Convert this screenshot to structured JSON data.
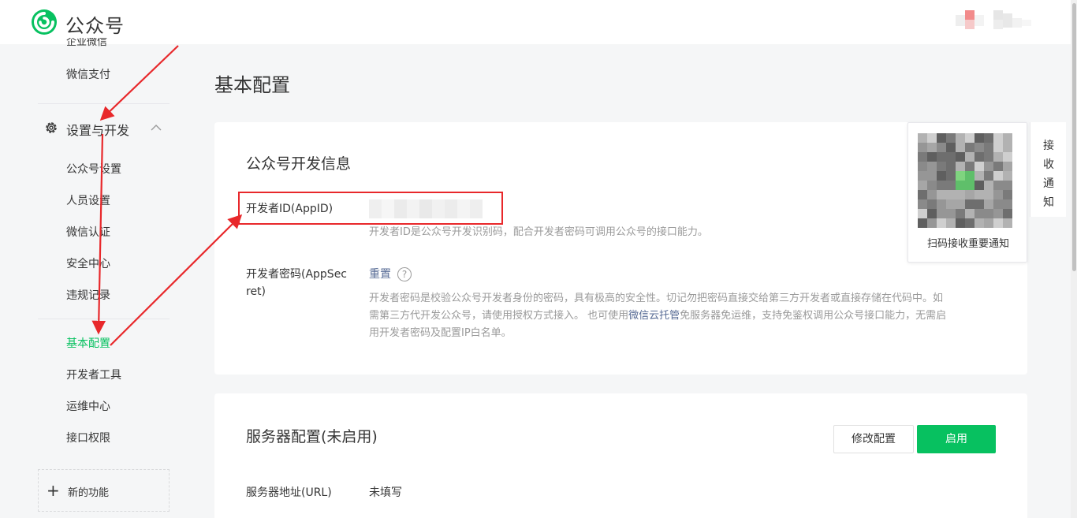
{
  "header": {
    "brand": "公众号"
  },
  "sidebar": {
    "cut_item": "企业微信",
    "wechat_pay": "微信支付",
    "group_label": "设置与开发",
    "items": [
      {
        "label": "公众号设置"
      },
      {
        "label": "人员设置"
      },
      {
        "label": "微信认证"
      },
      {
        "label": "安全中心"
      },
      {
        "label": "违规记录"
      },
      {
        "label": "基本配置"
      },
      {
        "label": "开发者工具"
      },
      {
        "label": "运维中心"
      },
      {
        "label": "接口权限"
      }
    ],
    "new_feature": "新的功能"
  },
  "main": {
    "page_title": "基本配置",
    "dev_info": {
      "title": "公众号开发信息",
      "appid_label": "开发者ID(AppID)",
      "appid_desc": "开发者ID是公众号开发识别码，配合开发者密码可调用公众号的接口能力。",
      "secret_label_1": "开发者密码(AppSec",
      "secret_label_2": "ret)",
      "reset_label": "重置",
      "help_glyph": "?",
      "secret_desc_1": "开发者密码是校验公众号开发者身份的密码，具有极高的安全性。切记勿把密码直接交给第三方开发者或直接存储在代码中。如",
      "secret_desc_2": "需第三方代开发公众号，请使用授权方式接入。 也可使用",
      "secret_desc_link": "微信云托管",
      "secret_desc_3": "免服务器免运维，支持免鉴权调用公众号接口能力，无需启",
      "secret_desc_4": "用开发者密码及配置IP白名单。"
    },
    "server": {
      "title": "服务器配置(未启用)",
      "modify_button": "修改配置",
      "enable_button": "启用",
      "url_label": "服务器地址(URL)",
      "url_value": "未填写"
    }
  },
  "qr_popup": {
    "caption": "扫码接收重要通知"
  },
  "notify_tab": {
    "label": "接收通知"
  },
  "colors": {
    "brand_green": "#07c160",
    "annotation_red": "#e8282b",
    "link_blue": "#576b95"
  }
}
